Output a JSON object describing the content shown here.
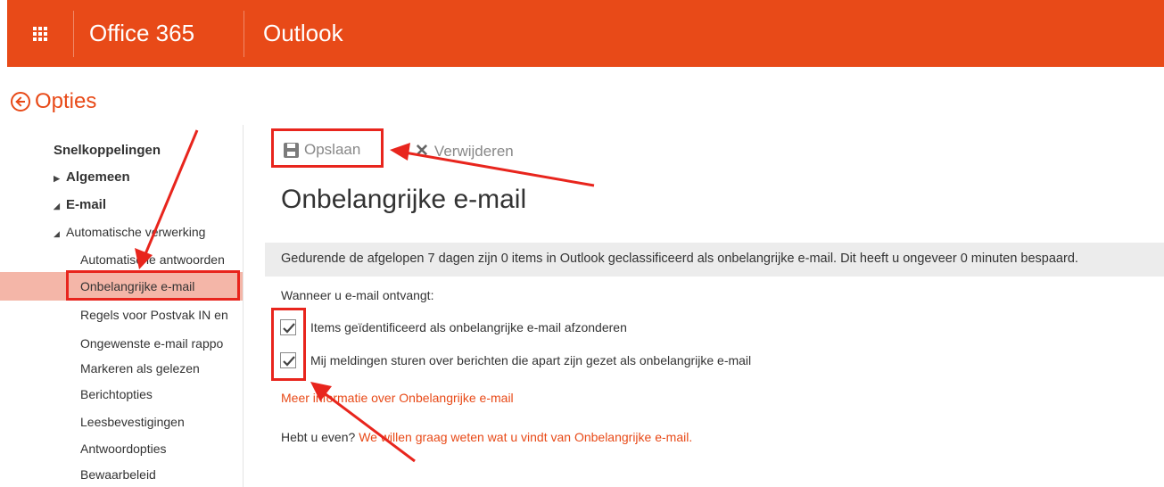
{
  "header": {
    "suite_name": "Office 365",
    "app_name": "Outlook"
  },
  "options": {
    "title": "Opties"
  },
  "sidebar": {
    "items": [
      {
        "label": "Snelkoppelingen"
      },
      {
        "label": "Algemeen"
      },
      {
        "label": "E-mail"
      },
      {
        "label": "Automatische verwerking"
      },
      {
        "label": "Automatische antwoorden"
      },
      {
        "label": "Onbelangrijke e-mail"
      },
      {
        "label": "Regels voor Postvak IN en"
      },
      {
        "label": "Ongewenste e-mail rappo"
      },
      {
        "label": "Markeren als gelezen"
      },
      {
        "label": "Berichtopties"
      },
      {
        "label": "Leesbevestigingen"
      },
      {
        "label": "Antwoordopties"
      },
      {
        "label": "Bewaarbeleid"
      }
    ]
  },
  "toolbar": {
    "save_label": "Opslaan",
    "delete_label": "Verwijderen"
  },
  "main": {
    "title": "Onbelangrijke e-mail",
    "info": "Gedurende de afgelopen 7 dagen zijn 0 items in Outlook geclassificeerd als onbelangrijke e-mail. Dit heeft u ongeveer 0 minuten bespaard.",
    "when_label": "Wanneer u e-mail ontvangt:",
    "options": [
      {
        "label": "Items geïdentificeerd als onbelangrijke e-mail afzonderen",
        "checked": true
      },
      {
        "label": "Mij meldingen sturen over berichten die apart zijn gezet als onbelangrijke e-mail",
        "checked": true
      }
    ],
    "more_info_link": "Meer informatie over Onbelangrijke e-mail",
    "feedback_prefix": "Hebt u even?",
    "feedback_link": "We willen graag weten wat u vindt van Onbelangrijke e-mail."
  },
  "colors": {
    "brand": "#e84a18",
    "selected": "#f4b6a8",
    "annotation": "#e8251d"
  }
}
